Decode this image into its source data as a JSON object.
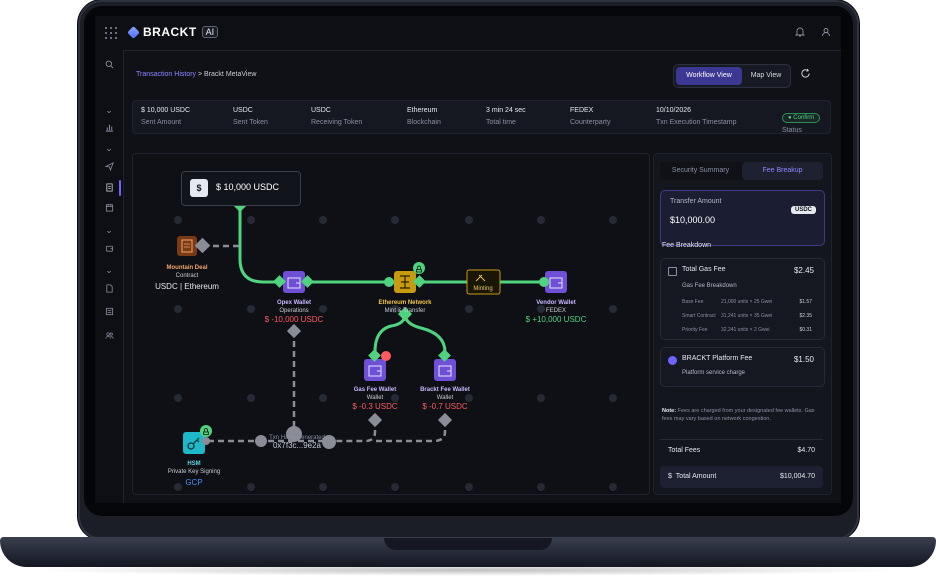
{
  "app": {
    "brand": "BRACKT",
    "brand_badge": "AI"
  },
  "breadcrumb": {
    "parent": "Transaction History",
    "separator": " > ",
    "current": "Brackt MetaView"
  },
  "view_toggle": {
    "workflow": "Workflow View",
    "map": "Map View",
    "active": "workflow"
  },
  "summary": [
    {
      "value": "$ 10,000 USDC",
      "label": "Sent Amount"
    },
    {
      "value": "USDC",
      "label": "Sent Token"
    },
    {
      "value": "USDC",
      "label": "Receiving Token"
    },
    {
      "value": "Ethereum",
      "label": "Blockchain"
    },
    {
      "value": "3 min 24 sec",
      "label": "Total time"
    },
    {
      "value": "FEDEX",
      "label": "Counterparty"
    },
    {
      "value": "10/10/2026",
      "label": "Txn Execution Timestamp"
    }
  ],
  "status": {
    "badge": "Confirm",
    "label": "Status",
    "color": "#4fd37f"
  },
  "flow": {
    "amount_box": "$ 10,000 USDC",
    "nodes": {
      "mountain": {
        "title": "Mountain Deal",
        "sub": "Contract",
        "extra": "USDC | Ethereum"
      },
      "opex": {
        "title": "Opex Wallet",
        "sub": "Operations",
        "extra": "$ -10,000 USDC"
      },
      "eth": {
        "title": "Ethereum Network",
        "sub": "Mint & Transfer"
      },
      "minting": {
        "title": "Minting"
      },
      "vendor": {
        "title": "Vendor Wallet",
        "sub": "FEDEX",
        "extra": "$ +10,000 USDC"
      },
      "gas": {
        "title": "Gas Fee Wallet",
        "sub": "Wallet",
        "extra": "$ -0.3 USDC"
      },
      "brackt": {
        "title": "Brackt Fee Wallet",
        "sub": "Wallet",
        "extra": "$ -0.7 USDC"
      },
      "hsm": {
        "title": "HSM",
        "sub": "Private Key Signing",
        "extra": "GCP"
      },
      "hash": {
        "title": "Txn Hash Generated",
        "sub": "0x7f3c...9e2a"
      }
    },
    "colors": {
      "green": "#4fd37f",
      "red": "#ff5a5f",
      "grey": "#8a8d96",
      "blue": "#4b8bff"
    }
  },
  "panel": {
    "tabs": [
      "Security Summary",
      "Fee Breakup"
    ],
    "active_tab": "Fee Breakup",
    "transfer": {
      "label": "Transfer Amount",
      "value": "$10,000.00",
      "token": "USDC"
    },
    "fee_breakdown_title": "Fee Breakdown",
    "gas": {
      "title": "Total Gas Fee",
      "amount": "$2.45",
      "sub": "Gas Fee Breakdown",
      "rows": [
        {
          "name": "Base Fee",
          "calc": "21,000 units × 25 Gwei",
          "value": "$1.57"
        },
        {
          "name": "Smart Contract",
          "calc": "31,241 units × 35 Gwei",
          "value": "$2.35"
        },
        {
          "name": "Priority Fee",
          "calc": "32,241 units × 2 Gwei",
          "value": "$0.31"
        }
      ]
    },
    "platform": {
      "title": "BRACKT Platform Fee",
      "amount": "$1.50",
      "sub": "Platform service charge"
    },
    "note_label": "Note:",
    "note": "Fees are charged from your designated fee wallets. Gas fees may vary based on network congestion.",
    "total_fees": {
      "label": "Total Fees",
      "value": "$4.70"
    },
    "total_amount": {
      "label": "Total Amount",
      "value": "$10,004.70"
    }
  }
}
